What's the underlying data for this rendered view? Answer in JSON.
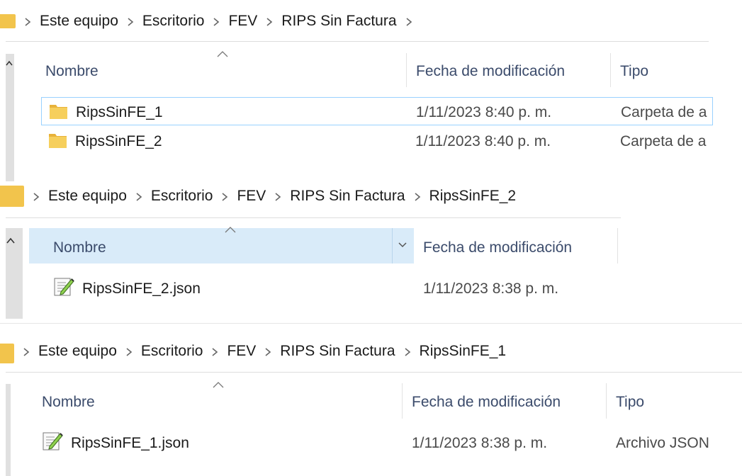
{
  "panels": [
    {
      "breadcrumb": [
        "Este equipo",
        "Escritorio",
        "FEV",
        "RIPS Sin Factura"
      ],
      "headers": {
        "name": "Nombre",
        "date": "Fecha de modificación",
        "type": "Tipo"
      },
      "rows": [
        {
          "name": "RipsSinFE_1",
          "date": "1/11/2023 8:40 p. m.",
          "type": "Carpeta de a",
          "icon": "folder-icon"
        },
        {
          "name": "RipsSinFE_2",
          "date": "1/11/2023 8:40 p. m.",
          "type": "Carpeta de a",
          "icon": "folder-icon"
        }
      ]
    },
    {
      "breadcrumb": [
        "Este equipo",
        "Escritorio",
        "FEV",
        "RIPS Sin Factura",
        "RipsSinFE_2"
      ],
      "headers": {
        "name": "Nombre",
        "date": "Fecha de modificación"
      },
      "rows": [
        {
          "name": "RipsSinFE_2.json",
          "date": "1/11/2023 8:38 p. m.",
          "icon": "json-file-icon"
        }
      ]
    },
    {
      "breadcrumb": [
        "Este equipo",
        "Escritorio",
        "FEV",
        "RIPS Sin Factura",
        "RipsSinFE_1"
      ],
      "headers": {
        "name": "Nombre",
        "date": "Fecha de modificación",
        "type": "Tipo"
      },
      "rows": [
        {
          "name": "RipsSinFE_1.json",
          "date": "1/11/2023 8:38 p. m.",
          "type": "Archivo JSON",
          "icon": "json-file-icon"
        }
      ]
    }
  ],
  "colors": {
    "folder": "#f2c44c",
    "selection_border": "#99d1ff",
    "header_highlight": "#d9ebf9",
    "header_text": "#3b4b6b"
  }
}
